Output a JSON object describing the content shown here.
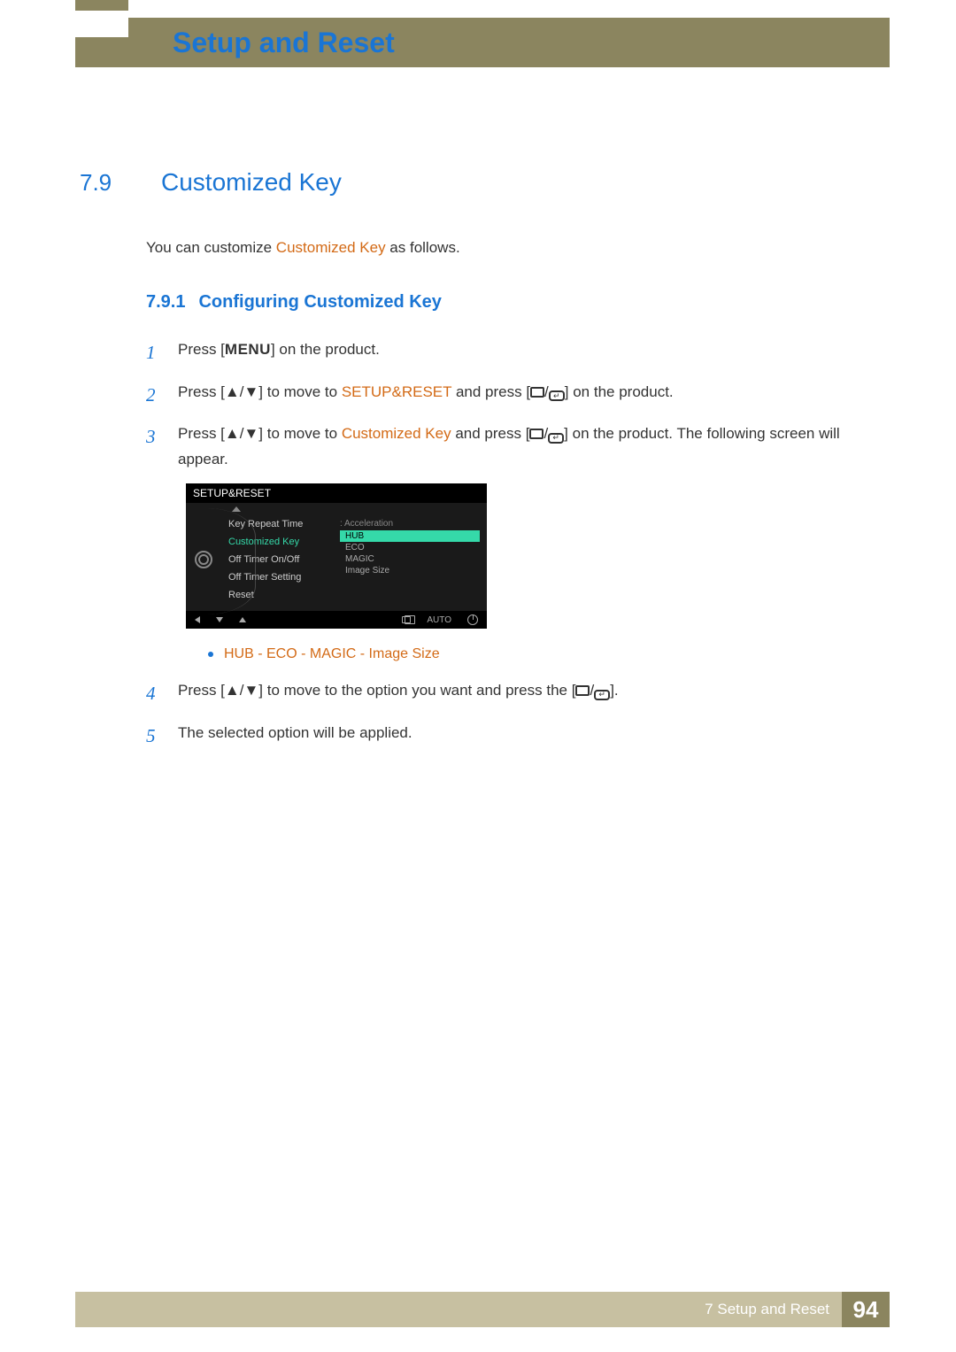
{
  "header": {
    "title": "Setup and Reset"
  },
  "section": {
    "number": "7.9",
    "title": "Customized Key"
  },
  "intro": {
    "pre": "You can customize ",
    "highlight": "Customized Key",
    "post": " as follows."
  },
  "subsection": {
    "number": "7.9.1",
    "title": "Configuring Customized Key"
  },
  "steps": {
    "s1": {
      "num": "1",
      "a": "Press [",
      "menu": "MENU",
      "b": "] on the product."
    },
    "s2": {
      "num": "2",
      "a": "Press [",
      "b": "] to move to ",
      "hl": "SETUP&RESET",
      "c": " and press [",
      "d": "] on the product."
    },
    "s3": {
      "num": "3",
      "a": "Press [",
      "b": "] to move to ",
      "hl": "Customized Key",
      "c": " and press [",
      "d": "] on the product. The following screen will appear."
    },
    "s4": {
      "num": "4",
      "a": "Press [",
      "b": "] to move to the option you want and press the [",
      "c": "]."
    },
    "s5": {
      "num": "5",
      "a": "The selected option will be applied."
    }
  },
  "bullet": {
    "text": "HUB - ECO - MAGIC - Image Size"
  },
  "osd": {
    "title": "SETUP&RESET",
    "menu": {
      "keyRepeat": "Key Repeat Time",
      "customized": "Customized Key",
      "offTimer": "Off Timer On/Off",
      "offTimerSetting": "Off Timer Setting",
      "reset": "Reset"
    },
    "right": {
      "accel": "Acceleration",
      "hub": "HUB",
      "eco": "ECO",
      "magic": "MAGIC",
      "imageSize": "Image Size"
    },
    "bottom": {
      "auto": "AUTO"
    }
  },
  "footer": {
    "chapter": "7 Setup and Reset",
    "page": "94"
  },
  "glyph": {
    "updown": "▲/▼",
    "slash": "/"
  }
}
